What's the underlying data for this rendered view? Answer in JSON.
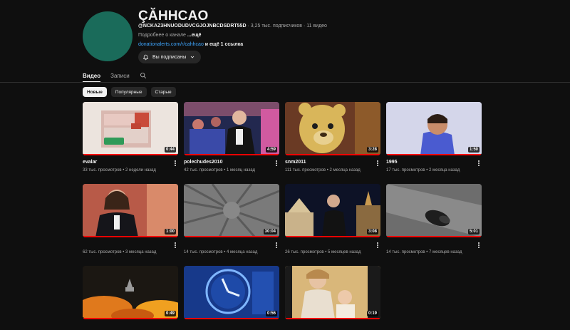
{
  "channel": {
    "name": "ÇĂHHCAO",
    "handle": "@NCKAZ3HNUODUDVCGJOJNBCDSDRT55D",
    "subscribers": "3,25 тыс. подписчиков",
    "videos_count": "11 видео",
    "separator": " · ",
    "description": "Подробнее о канале ",
    "more_label": "...ещё",
    "link_url": "donationalerts.com/r/cahhcao",
    "link_extra": " и ещё 1 ссылка",
    "subscribe_label": "Вы подписаны",
    "avatar_color": "#1a6b5a"
  },
  "tabs": [
    {
      "label": "Видео",
      "active": true
    },
    {
      "label": "Записи",
      "active": false
    }
  ],
  "chips": [
    {
      "label": "Новые",
      "active": true
    },
    {
      "label": "Популярные",
      "active": false
    },
    {
      "label": "Старые",
      "active": false
    }
  ],
  "videos": [
    {
      "title": "evalar",
      "views": "33 тыс. просмотров",
      "age": "2 недели назад",
      "duration": "0:44",
      "watched_progress": 1.0
    },
    {
      "title": "polechudes2010",
      "views": "42 тыс. просмотров",
      "age": "1 месяц назад",
      "duration": "4:59",
      "watched_progress": 1.0
    },
    {
      "title": "snm2011",
      "views": "111 тыс. просмотров",
      "age": "2 месяца назад",
      "duration": "3:28",
      "watched_progress": 1.0
    },
    {
      "title": "1995",
      "views": "17 тыс. просмотров",
      "age": "2 месяца назад",
      "duration": "1:50",
      "watched_progress": 1.0
    },
    {
      "title": "",
      "views": "62 тыс. просмотров",
      "age": "3 месяца назад",
      "duration": "1:00",
      "watched_progress": 1.0
    },
    {
      "title": "",
      "views": "14 тыс. просмотров",
      "age": "4 месяца назад",
      "duration": "30:04",
      "watched_progress": 1.0
    },
    {
      "title": "",
      "views": "26 тыс. просмотров",
      "age": "5 месяцев назад",
      "duration": "3:08",
      "watched_progress": 1.0
    },
    {
      "title": "",
      "views": "14 тыс. просмотров",
      "age": "7 месяцев назад",
      "duration": "5:01",
      "watched_progress": 1.0
    },
    {
      "title": "",
      "views": "",
      "age": "",
      "duration": "0:49",
      "watched_progress": 1.0
    },
    {
      "title": "",
      "views": "",
      "age": "",
      "duration": "0:56",
      "watched_progress": 1.0
    },
    {
      "title": "",
      "views": "",
      "age": "",
      "duration": "0:19",
      "watched_progress": 1.0
    }
  ],
  "colors": {
    "background": "#0f0f0f",
    "progress": "#ff0000",
    "link": "#3ea6ff",
    "secondary_text": "#aaaaaa"
  }
}
